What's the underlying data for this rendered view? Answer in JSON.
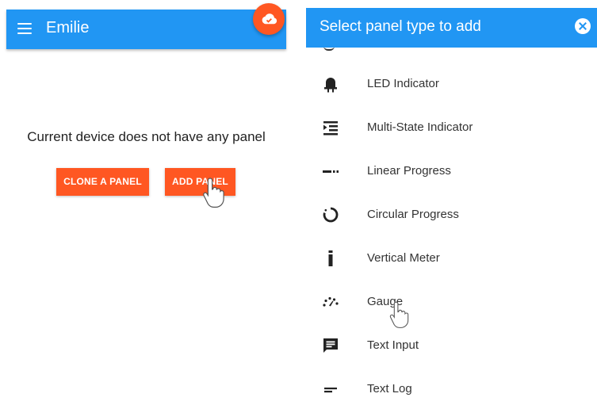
{
  "left": {
    "title": "Emilie",
    "empty_message": "Current device does not have any panel",
    "clone_button": "CLONE A PANEL",
    "add_button": "ADD PANEL"
  },
  "right": {
    "title": "Select panel type to add",
    "items": [
      {
        "label": "LED Indicator",
        "icon": "led-icon"
      },
      {
        "label": "Multi-State Indicator",
        "icon": "multi-state-icon"
      },
      {
        "label": "Linear Progress",
        "icon": "linear-progress-icon"
      },
      {
        "label": "Circular Progress",
        "icon": "circular-progress-icon"
      },
      {
        "label": "Vertical Meter",
        "icon": "vertical-meter-icon"
      },
      {
        "label": "Gauge",
        "icon": "gauge-icon"
      },
      {
        "label": "Text Input",
        "icon": "text-input-icon"
      },
      {
        "label": "Text Log",
        "icon": "text-log-icon"
      }
    ]
  },
  "colors": {
    "primary": "#2196f3",
    "accent": "#ff5722"
  }
}
